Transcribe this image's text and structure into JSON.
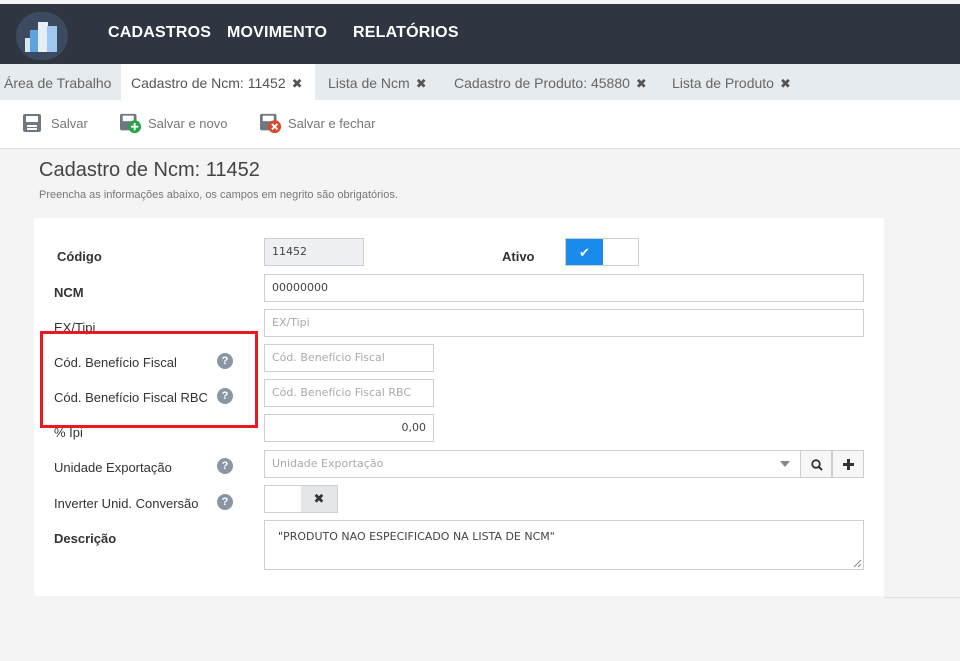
{
  "header": {
    "menu": [
      "CADASTROS",
      "MOVIMENTO",
      "RELATÓRIOS"
    ]
  },
  "tabs": [
    {
      "label": "Área de Trabalho",
      "closable": false,
      "active": false
    },
    {
      "label": "Cadastro de Ncm: 11452",
      "closable": true,
      "active": true
    },
    {
      "label": "Lista de Ncm",
      "closable": true,
      "active": false
    },
    {
      "label": "Cadastro de Produto: 45880",
      "closable": true,
      "active": false
    },
    {
      "label": "Lista de Produto",
      "closable": true,
      "active": false
    }
  ],
  "close_glyph": "✖",
  "toolbar": {
    "save_label": "Salvar",
    "save_new_label": "Salvar e novo",
    "save_close_label": "Salvar e fechar"
  },
  "page": {
    "title": "Cadastro de Ncm: 11452",
    "subtitle": "Preencha as informações abaixo, os campos em negrito são obrigatórios."
  },
  "form": {
    "codigo": {
      "label": "Código",
      "value": "11452"
    },
    "ativo": {
      "label": "Ativo",
      "checked": true,
      "check_glyph": "✔"
    },
    "ncm": {
      "label": "NCM",
      "value": "00000000"
    },
    "ex_tipi": {
      "label": "EX/Tipi",
      "placeholder": "EX/Tipi"
    },
    "cod_beneficio": {
      "label": "Cód. Benefício Fiscal",
      "placeholder": "Cód. Benefício Fiscal"
    },
    "cod_beneficio_rbc": {
      "label": "Cód. Benefício Fiscal RBC",
      "placeholder": "Cód. Benefício Fiscal RBC"
    },
    "ipi": {
      "label": "% Ipi",
      "value": "0,00"
    },
    "unidade_exportacao": {
      "label": "Unidade Exportação",
      "placeholder": "Unidade Exportação"
    },
    "inverter_unid": {
      "label": "Inverter Unid. Conversão",
      "checked": false,
      "off_glyph": "✖"
    },
    "descricao": {
      "label": "Descrição",
      "value": "\"PRODUTO NAO ESPECIFICADO NA LISTA DE NCM\""
    }
  },
  "help_glyph": "?",
  "colors": {
    "topbar": "#2f3541",
    "accent": "#1a8bea",
    "highlight_box": "#e8191f"
  }
}
